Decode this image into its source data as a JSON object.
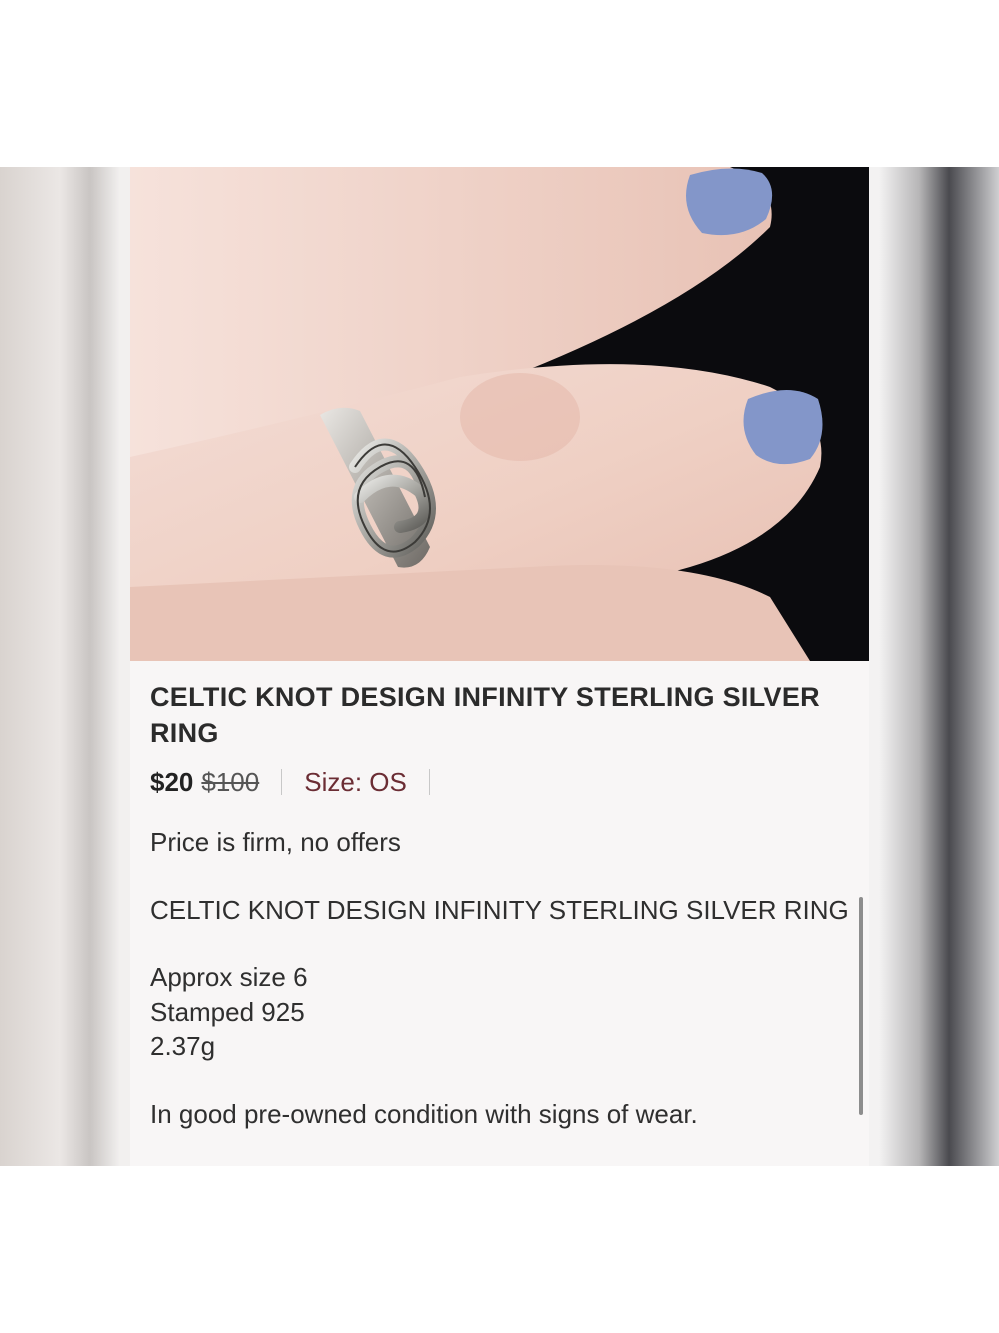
{
  "listing": {
    "title": "CELTIC KNOT DESIGN INFINITY STERLING SILVER RING",
    "price": "$20",
    "original_price": "$100",
    "size_label": "Size: OS",
    "description": [
      "Price is firm, no offers",
      "CELTIC KNOT DESIGN INFINITY STERLING SILVER RING",
      "Approx size 6\nStamped 925\n2.37g",
      "In good pre-owned condition with signs of wear."
    ]
  },
  "colors": {
    "size_text": "#6b2d34",
    "nail_polish": "#8396c9",
    "background_dark": "#0b0b0e"
  },
  "icons": {
    "photo": "product-photo-ring-on-finger"
  }
}
